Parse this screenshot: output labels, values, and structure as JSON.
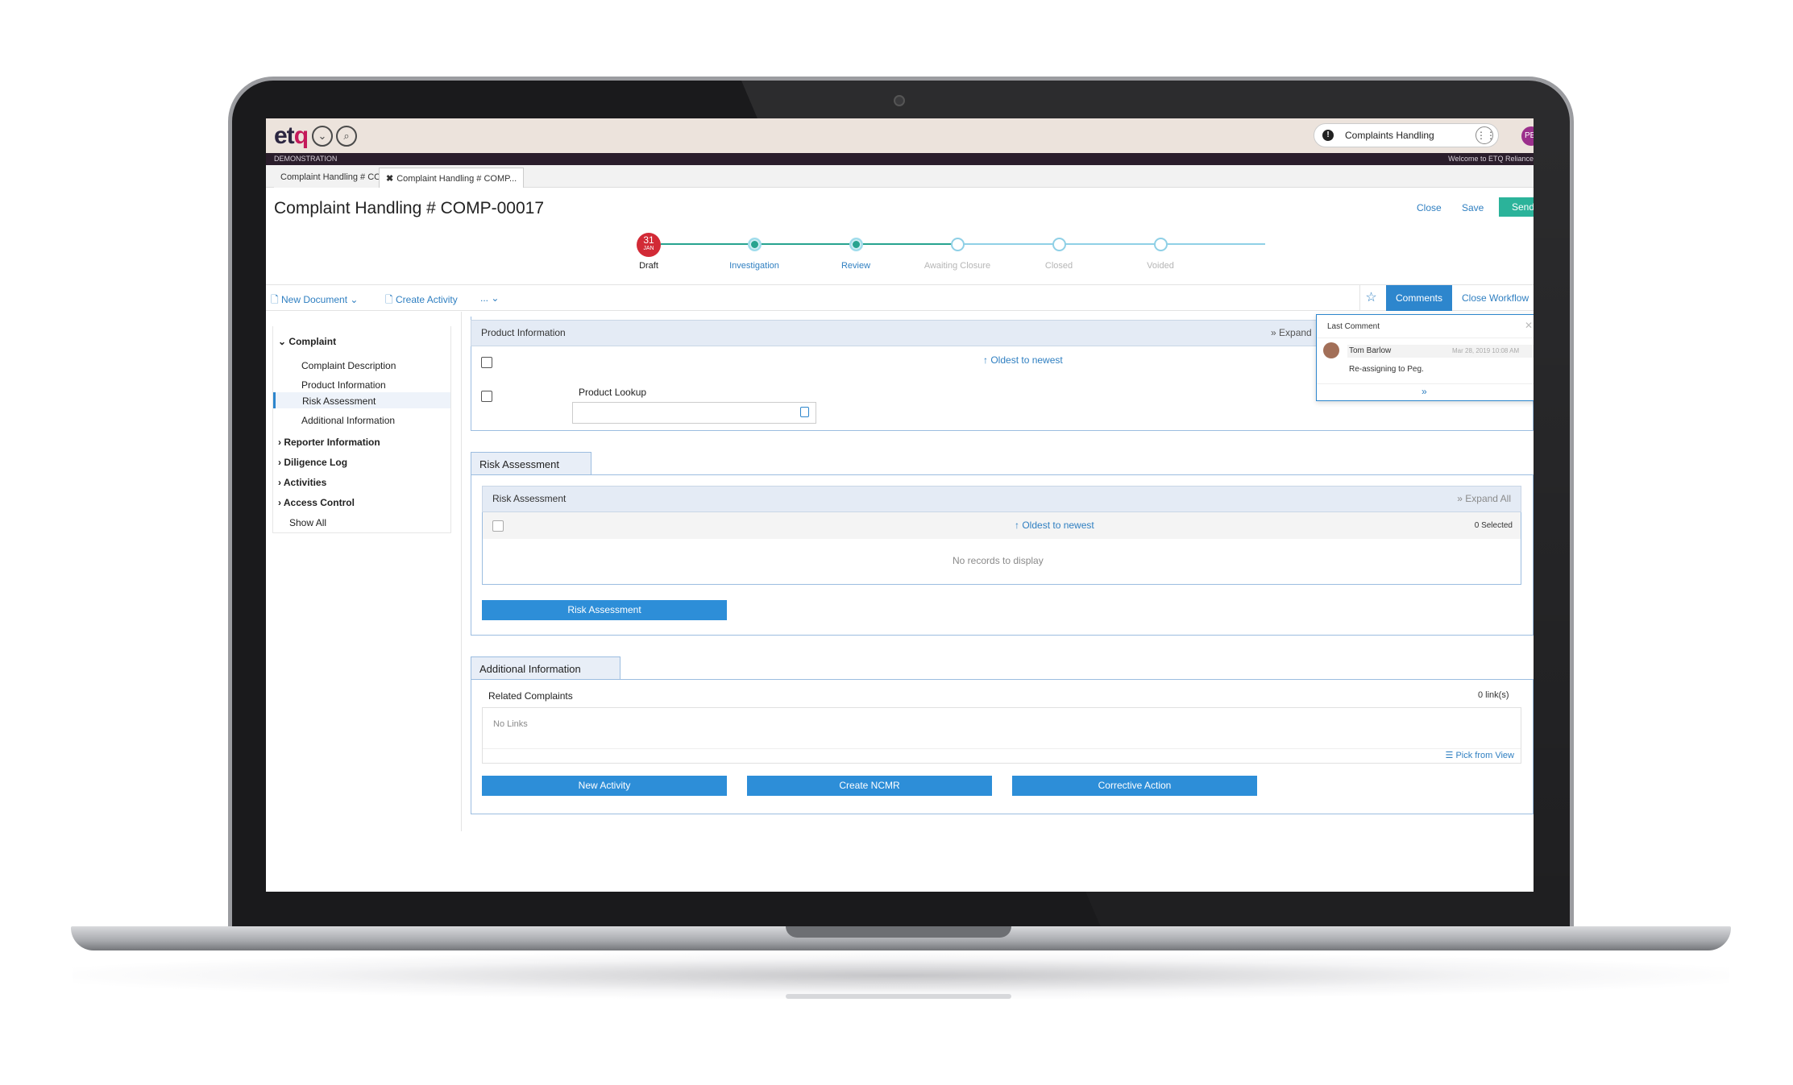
{
  "app": {
    "logo_text": "etq",
    "environment": "DEMONSTRATION",
    "welcome": "Welcome to ETQ Reliance",
    "app_name": "Complaints Handling",
    "user_initials": "PE"
  },
  "tabs": [
    {
      "label": "Complaint Handling # COMP-...",
      "active": false
    },
    {
      "label": "Complaint Handling # COMP...",
      "active": true,
      "close": "✖"
    }
  ],
  "document": {
    "title": "Complaint Handling # COMP-00017",
    "actions": {
      "close": "Close",
      "save": "Save",
      "send": "Send"
    }
  },
  "workflow": {
    "date_day": "31",
    "date_month": "JAN",
    "steps": [
      {
        "label": "Draft",
        "state": "current"
      },
      {
        "label": "Investigation",
        "state": "done"
      },
      {
        "label": "Review",
        "state": "done"
      },
      {
        "label": "Awaiting Closure",
        "state": "pending"
      },
      {
        "label": "Closed",
        "state": "pending"
      },
      {
        "label": "Voided",
        "state": "pending"
      }
    ]
  },
  "toolbar": {
    "new_document": "New Document",
    "create_activity": "Create Activity",
    "more": "...",
    "comments": "Comments",
    "close_workflow": "Close Workflow"
  },
  "nav": {
    "complaint": "Complaint",
    "complaint_items": [
      "Complaint Description",
      "Product Information",
      "Risk Assessment",
      "Additional Information"
    ],
    "selected": "Risk Assessment",
    "reporter_information": "Reporter Information",
    "diligence_log": "Diligence Log",
    "activities": "Activities",
    "access_control": "Access Control",
    "show_all": "Show All"
  },
  "product_info": {
    "header": "Product Information",
    "expand": "Expand",
    "sort": "Oldest to newest",
    "lookup_label": "Product Lookup",
    "lookup_value": ""
  },
  "risk_section": {
    "tab": "Risk Assessment",
    "header": "Risk Assessment",
    "expand_all": "Expand All",
    "sort": "Oldest to newest",
    "selected": "0 Selected",
    "empty": "No records to display",
    "button": "Risk Assessment"
  },
  "additional_section": {
    "tab": "Additional Information",
    "related_label": "Related Complaints",
    "links_count": "0 link(s)",
    "no_links": "No Links",
    "pick_from_view": "Pick from View",
    "buttons": [
      "New Activity",
      "Create NCMR",
      "Corrective Action"
    ]
  },
  "comment_popup": {
    "title": "Last Comment",
    "author": "Tom Barlow",
    "date": "Mar 28, 2019 10:08 AM",
    "text": "Re-assigning to Peg."
  },
  "colors": {
    "accent": "#2d86cd",
    "send": "#2bb39a",
    "date_badge": "#d22a36",
    "topbar": "#ece3dc",
    "strip": "#2a1d2b"
  }
}
